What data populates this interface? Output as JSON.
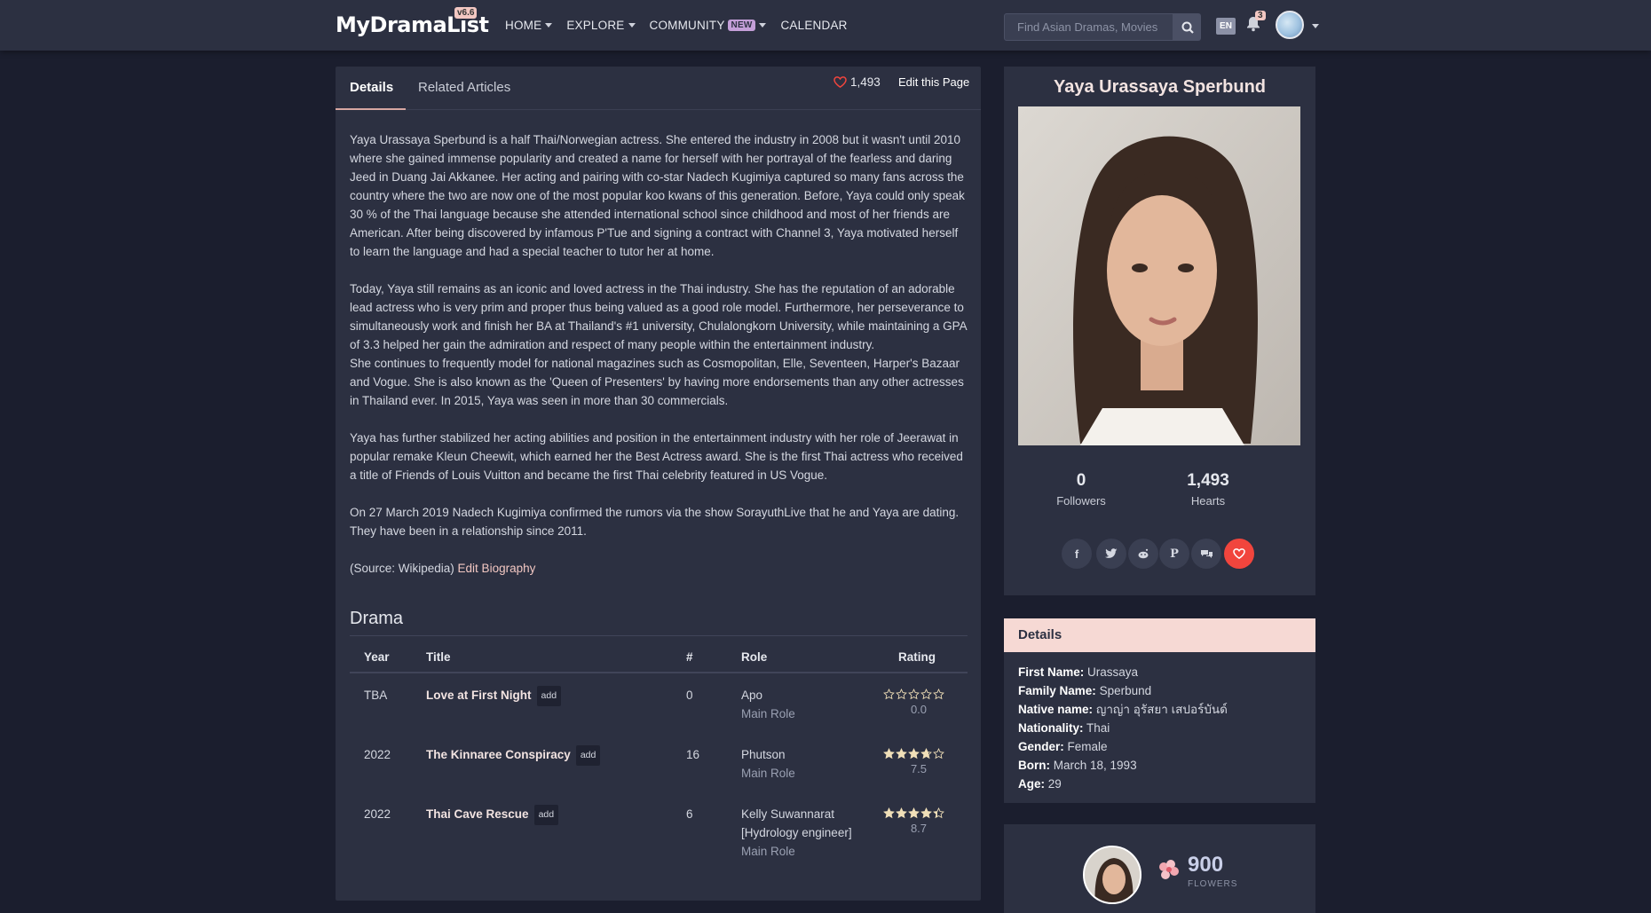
{
  "nav": {
    "logo": "MyDramaList",
    "version": "v6.6",
    "menu": [
      {
        "label": "HOME",
        "caret": true
      },
      {
        "label": "EXPLORE",
        "caret": true
      },
      {
        "label": "COMMUNITY",
        "badge": "NEW",
        "caret": true
      },
      {
        "label": "CALENDAR",
        "caret": false
      }
    ],
    "search_placeholder": "Find Asian Dramas, Movies",
    "lang": "EN",
    "notifications": "3"
  },
  "tabs": {
    "details": "Details",
    "related": "Related Articles",
    "hearts": "1,493",
    "edit_page": "Edit this Page"
  },
  "bio": {
    "p1": "Yaya Urassaya Sperbund is a half Thai/Norwegian actress. She entered the industry in 2008 but it wasn't until 2010 where she gained immense popularity and created a name for herself with her portrayal of the fearless and daring Jeed in Duang Jai Akkanee. Her acting and pairing with co-star Nadech Kugimiya captured so many fans across the country where the two are now one of the most popular koo kwans of this generation. Before, Yaya could only speak 30 % of the Thai language because she attended international school since childhood and most of her friends are American. After being discovered by infamous P'Tue and signing a contract with Channel 3, Yaya motivated herself to learn the language and had a special teacher to tutor her at home.",
    "p2": "Today, Yaya still remains as an iconic and loved actress in the Thai industry. She has the reputation of an adorable lead actress who is very prim and proper thus being valued as a good role model. Furthermore, her perseverance to simultaneously work and finish her BA at Thailand's #1 university, Chulalongkorn University, while maintaining a GPA of 3.3 helped her gain the admiration and respect of many people within the entertainment industry.",
    "p3": "She continues to frequently model for national magazines such as Cosmopolitan, Elle, Seventeen, Harper's Bazaar and Vogue. She is also known as the 'Queen of Presenters' by having more endorsements than any other actresses in Thailand ever. In 2015, Yaya was seen in more than 30 commercials.",
    "p4": "Yaya has further stabilized her acting abilities and position in the entertainment industry with her role of Jeerawat in popular remake Kleun Cheewit, which earned her the Best Actress award. She is the first Thai actress who received a title of Friends of Louis Vuitton and became the first Thai celebrity featured in US Vogue.",
    "p5": "On 27 March 2019 Nadech Kugimiya confirmed the rumors via the show SorayuthLive that he and Yaya are dating. They have been in a relationship since 2011.",
    "source": "(Source: Wikipedia) ",
    "edit_bio": "Edit Biography"
  },
  "drama": {
    "heading": "Drama",
    "columns": {
      "year": "Year",
      "title": "Title",
      "eps": "#",
      "role": "Role",
      "rating": "Rating"
    },
    "add_label": "add",
    "rows": [
      {
        "year": "TBA",
        "title": "Love at First Night",
        "eps": "0",
        "role": "Apo",
        "role_type": "Main Role",
        "rating": "0.0",
        "stars": 0
      },
      {
        "year": "2022",
        "title": "The Kinnaree Conspiracy",
        "eps": "16",
        "role": "Phutson",
        "role_type": "Main Role",
        "rating": "7.5",
        "stars": 3.75
      },
      {
        "year": "2022",
        "title": "Thai Cave Rescue",
        "eps": "6",
        "role": "Kelly Suwannarat [Hydrology engineer]",
        "role_type": "Main Role",
        "rating": "8.7",
        "stars": 4.35
      }
    ]
  },
  "profile": {
    "name": "Yaya Urassaya Sperbund",
    "followers_num": "0",
    "followers_label": "Followers",
    "hearts_num": "1,493",
    "hearts_label": "Hearts"
  },
  "details": {
    "heading": "Details",
    "items": [
      {
        "k": "First Name:",
        "v": "Urassaya"
      },
      {
        "k": "Family Name:",
        "v": "Sperbund"
      },
      {
        "k": "Native name:",
        "v": "ญาญ่า อุรัสยา เสปอร์บันด์"
      },
      {
        "k": "Nationality:",
        "v": "Thai"
      },
      {
        "k": "Gender:",
        "v": "Female"
      },
      {
        "k": "Born:",
        "v": "March 18, 1993"
      },
      {
        "k": "Age:",
        "v": "29"
      }
    ]
  },
  "flowers": {
    "count": "900",
    "label": "FLOWERS"
  },
  "colors": {
    "bg": "#1b1e2e",
    "panel": "#2c3041",
    "accent_pink": "#f2c7c2",
    "heart_red": "#f1453d",
    "star": "#f0dfb8"
  }
}
